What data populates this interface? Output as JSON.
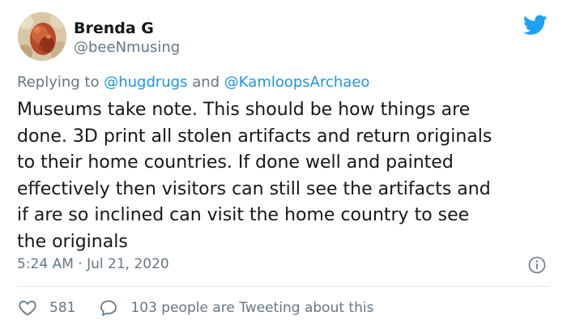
{
  "author": {
    "display_name": "Brenda G",
    "handle": "@beeNmusing"
  },
  "icons": {
    "brand": "twitter-bird-icon",
    "info": "info-circle-icon",
    "like": "heart-icon",
    "reply": "speech-bubble-icon"
  },
  "reply_context": {
    "prefix": "Replying to ",
    "mention_1": "@hugdrugs",
    "joiner": " and ",
    "mention_2": "@KamloopsArchaeo"
  },
  "tweet": {
    "lines": [
      "Museums take note. This should be how things are",
      "done. 3D print all stolen artifacts and return originals",
      "to their home countries. If done well and painted",
      "effectively then visitors can still see the artifacts and",
      "if are so inclined can visit the home country to see",
      "the originals"
    ]
  },
  "meta": {
    "timestamp": "5:24 AM · Jul 21, 2020"
  },
  "engagement": {
    "likes": "581",
    "conversation": "103 people are Tweeting about this"
  },
  "colors": {
    "accent": "#1da1f2",
    "mention": "#1b95e0",
    "text": "#14171a",
    "muted": "#657786",
    "divider": "#e1e8ed"
  }
}
